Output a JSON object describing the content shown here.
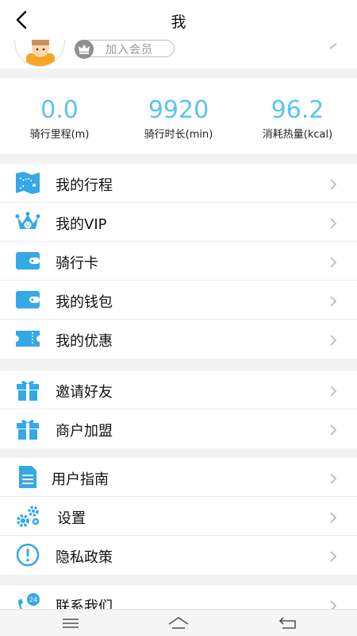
{
  "header": {
    "title": "我"
  },
  "profile": {
    "vip_label": "加入会员"
  },
  "stats": [
    {
      "value": "0.0",
      "label": "骑行里程(m)"
    },
    {
      "value": "9920",
      "label": "骑行时长(min)"
    },
    {
      "value": "96.2",
      "label": "消耗热量(kcal)"
    }
  ],
  "menu": {
    "group1": [
      {
        "label": "我的行程",
        "icon": "map-icon"
      },
      {
        "label": "我的VIP",
        "icon": "crown-icon"
      },
      {
        "label": "骑行卡",
        "icon": "card-icon"
      },
      {
        "label": "我的钱包",
        "icon": "wallet-icon"
      },
      {
        "label": "我的优惠",
        "icon": "coupon-icon"
      }
    ],
    "group2": [
      {
        "label": "邀请好友",
        "icon": "gift-icon"
      },
      {
        "label": "商户加盟",
        "icon": "gift-icon"
      }
    ],
    "group3": [
      {
        "label": "用户指南",
        "icon": "document-icon"
      },
      {
        "label": "设置",
        "icon": "gears-icon"
      },
      {
        "label": "隐私政策",
        "icon": "info-icon"
      }
    ],
    "group4": [
      {
        "label": "联系我们",
        "icon": "support-24-icon",
        "badge": "24"
      }
    ]
  },
  "colors": {
    "accent": "#5cc4ee",
    "icon_blue": "#35a8e8"
  },
  "navbar": {
    "icons": [
      "menu-icon",
      "home-icon",
      "back-icon"
    ]
  }
}
